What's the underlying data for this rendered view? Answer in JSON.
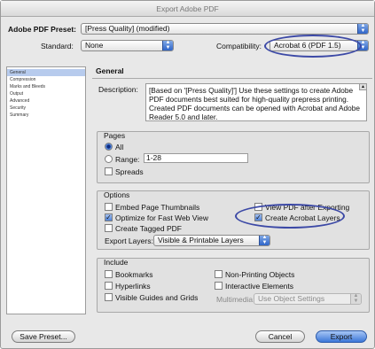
{
  "window": {
    "title": "Export Adobe PDF"
  },
  "header": {
    "preset_label": "Adobe PDF Preset:",
    "preset_value": "[Press Quality] (modified)",
    "standard_label": "Standard:",
    "standard_value": "None",
    "compat_label": "Compatibility:",
    "compat_value": "Acrobat 6 (PDF 1.5)"
  },
  "sidebar": {
    "items": [
      {
        "label": "General",
        "selected": true
      },
      {
        "label": "Compression"
      },
      {
        "label": "Marks and Bleeds"
      },
      {
        "label": "Output"
      },
      {
        "label": "Advanced"
      },
      {
        "label": "Security"
      },
      {
        "label": "Summary"
      }
    ]
  },
  "main": {
    "section_title": "General",
    "description_label": "Description:",
    "description_text": "[Based on '[Press Quality]'] Use these settings to create Adobe PDF documents best suited for high-quality prepress printing.  Created PDF documents can be opened with Acrobat and Adobe Reader 5.0 and later."
  },
  "pages": {
    "title": "Pages",
    "all_label": "All",
    "range_label": "Range:",
    "range_value": "1-28",
    "spreads_label": "Spreads",
    "selected": "all",
    "spreads_checked": false
  },
  "options": {
    "title": "Options",
    "embed_thumbnails": {
      "label": "Embed Page Thumbnails",
      "checked": false
    },
    "optimize_web": {
      "label": "Optimize for Fast Web View",
      "checked": true
    },
    "tagged_pdf": {
      "label": "Create Tagged PDF",
      "checked": false
    },
    "view_after": {
      "label": "View PDF after Exporting",
      "checked": false
    },
    "acrobat_layers": {
      "label": "Create Acrobat Layers",
      "checked": true
    },
    "export_layers_label": "Export Layers:",
    "export_layers_value": "Visible & Printable Layers"
  },
  "include": {
    "title": "Include",
    "bookmarks": {
      "label": "Bookmarks",
      "checked": false
    },
    "hyperlinks": {
      "label": "Hyperlinks",
      "checked": false
    },
    "guides": {
      "label": "Visible Guides and Grids",
      "checked": false
    },
    "non_printing": {
      "label": "Non-Printing Objects",
      "checked": false
    },
    "interactive": {
      "label": "Interactive Elements",
      "checked": false
    },
    "multimedia_label": "Multimedia:",
    "multimedia_value": "Use Object Settings"
  },
  "buttons": {
    "save_preset": "Save Preset...",
    "cancel": "Cancel",
    "export": "Export"
  },
  "colors": {
    "annotation": "#3c49a6",
    "accent": "#3c77d8"
  }
}
